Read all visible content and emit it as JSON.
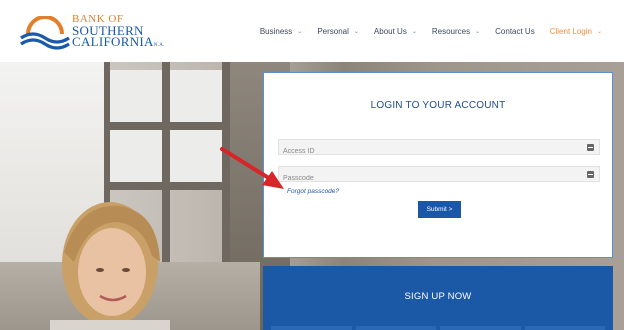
{
  "logo": {
    "line1": "BANK OF",
    "line2": "SOUTHERN",
    "line3": "CALIFORNIA",
    "suffix": "N.A."
  },
  "nav": [
    {
      "label": "Business",
      "icon": "chevron-down-icon"
    },
    {
      "label": "Personal",
      "icon": "chevron-down-icon"
    },
    {
      "label": "About Us",
      "icon": "chevron-down-icon"
    },
    {
      "label": "Resources",
      "icon": "chevron-down-icon"
    },
    {
      "label": "Contact Us"
    },
    {
      "label": "Client Login",
      "icon": "chevron-down-icon",
      "active": true
    }
  ],
  "login": {
    "title": "LOGIN TO YOUR ACCOUNT",
    "access_id_placeholder": "Access ID",
    "passcode_placeholder": "Passcode",
    "forgot_label": "Forgot passcode?",
    "submit_label": "Submit >"
  },
  "signup": {
    "title": "SIGN UP NOW"
  },
  "colors": {
    "brand_blue": "#1b58a6",
    "brand_orange": "#f0913d",
    "annotation_red": "#d8252a"
  }
}
